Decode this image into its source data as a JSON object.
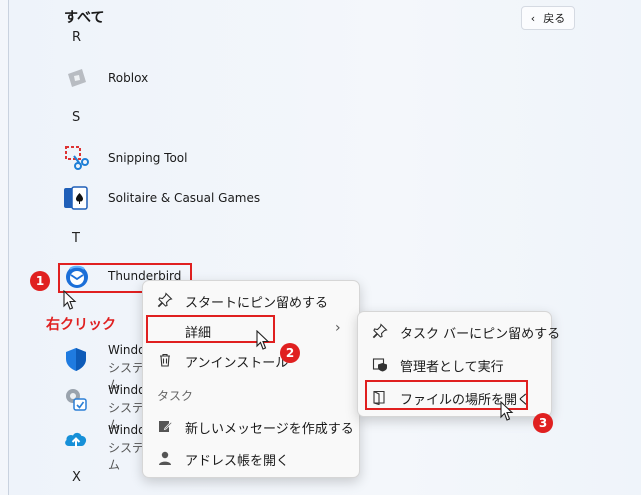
{
  "header": {
    "title": "すべて",
    "back_label": "戻る"
  },
  "letters": {
    "r": "R",
    "s": "S",
    "t": "T",
    "x": "X"
  },
  "apps": {
    "roblox": "Roblox",
    "snipping": "Snipping Tool",
    "solitaire": "Solitaire & Casual Games",
    "thunderbird": "Thunderbird",
    "win1": "Windo",
    "win1_sub": "システム",
    "win2": "Windo",
    "win2_sub": "システム",
    "win3": "Windo",
    "win3_sub": "システム"
  },
  "context_menu": {
    "pin_start": "スタートにピン留めする",
    "details": "詳細",
    "uninstall": "アンインストール",
    "section_task": "タスク",
    "new_message": "新しいメッセージを作成する",
    "address_book": "アドレス帳を開く"
  },
  "submenu": {
    "pin_taskbar": "タスク バーにピン留めする",
    "run_admin": "管理者として実行",
    "open_location": "ファイルの場所を開く"
  },
  "annotations": {
    "step1": "1",
    "step2": "2",
    "step3": "3",
    "right_click": "右クリック"
  },
  "colors": {
    "accent_red": "#e02020",
    "menu_bg": "#f9f9f9"
  }
}
